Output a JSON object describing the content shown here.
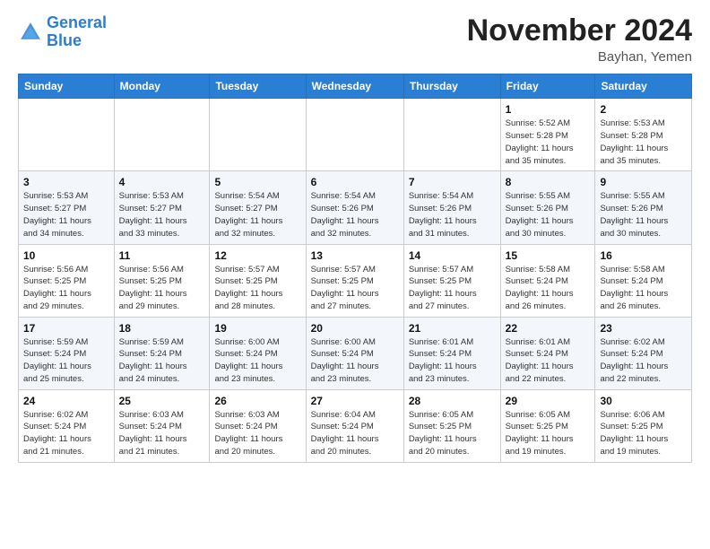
{
  "header": {
    "logo_line1": "General",
    "logo_line2": "Blue",
    "month_title": "November 2024",
    "location": "Bayhan, Yemen"
  },
  "days_of_week": [
    "Sunday",
    "Monday",
    "Tuesday",
    "Wednesday",
    "Thursday",
    "Friday",
    "Saturday"
  ],
  "weeks": [
    [
      {
        "day": "",
        "info": ""
      },
      {
        "day": "",
        "info": ""
      },
      {
        "day": "",
        "info": ""
      },
      {
        "day": "",
        "info": ""
      },
      {
        "day": "",
        "info": ""
      },
      {
        "day": "1",
        "info": "Sunrise: 5:52 AM\nSunset: 5:28 PM\nDaylight: 11 hours\nand 35 minutes."
      },
      {
        "day": "2",
        "info": "Sunrise: 5:53 AM\nSunset: 5:28 PM\nDaylight: 11 hours\nand 35 minutes."
      }
    ],
    [
      {
        "day": "3",
        "info": "Sunrise: 5:53 AM\nSunset: 5:27 PM\nDaylight: 11 hours\nand 34 minutes."
      },
      {
        "day": "4",
        "info": "Sunrise: 5:53 AM\nSunset: 5:27 PM\nDaylight: 11 hours\nand 33 minutes."
      },
      {
        "day": "5",
        "info": "Sunrise: 5:54 AM\nSunset: 5:27 PM\nDaylight: 11 hours\nand 32 minutes."
      },
      {
        "day": "6",
        "info": "Sunrise: 5:54 AM\nSunset: 5:26 PM\nDaylight: 11 hours\nand 32 minutes."
      },
      {
        "day": "7",
        "info": "Sunrise: 5:54 AM\nSunset: 5:26 PM\nDaylight: 11 hours\nand 31 minutes."
      },
      {
        "day": "8",
        "info": "Sunrise: 5:55 AM\nSunset: 5:26 PM\nDaylight: 11 hours\nand 30 minutes."
      },
      {
        "day": "9",
        "info": "Sunrise: 5:55 AM\nSunset: 5:26 PM\nDaylight: 11 hours\nand 30 minutes."
      }
    ],
    [
      {
        "day": "10",
        "info": "Sunrise: 5:56 AM\nSunset: 5:25 PM\nDaylight: 11 hours\nand 29 minutes."
      },
      {
        "day": "11",
        "info": "Sunrise: 5:56 AM\nSunset: 5:25 PM\nDaylight: 11 hours\nand 29 minutes."
      },
      {
        "day": "12",
        "info": "Sunrise: 5:57 AM\nSunset: 5:25 PM\nDaylight: 11 hours\nand 28 minutes."
      },
      {
        "day": "13",
        "info": "Sunrise: 5:57 AM\nSunset: 5:25 PM\nDaylight: 11 hours\nand 27 minutes."
      },
      {
        "day": "14",
        "info": "Sunrise: 5:57 AM\nSunset: 5:25 PM\nDaylight: 11 hours\nand 27 minutes."
      },
      {
        "day": "15",
        "info": "Sunrise: 5:58 AM\nSunset: 5:24 PM\nDaylight: 11 hours\nand 26 minutes."
      },
      {
        "day": "16",
        "info": "Sunrise: 5:58 AM\nSunset: 5:24 PM\nDaylight: 11 hours\nand 26 minutes."
      }
    ],
    [
      {
        "day": "17",
        "info": "Sunrise: 5:59 AM\nSunset: 5:24 PM\nDaylight: 11 hours\nand 25 minutes."
      },
      {
        "day": "18",
        "info": "Sunrise: 5:59 AM\nSunset: 5:24 PM\nDaylight: 11 hours\nand 24 minutes."
      },
      {
        "day": "19",
        "info": "Sunrise: 6:00 AM\nSunset: 5:24 PM\nDaylight: 11 hours\nand 23 minutes."
      },
      {
        "day": "20",
        "info": "Sunrise: 6:00 AM\nSunset: 5:24 PM\nDaylight: 11 hours\nand 23 minutes."
      },
      {
        "day": "21",
        "info": "Sunrise: 6:01 AM\nSunset: 5:24 PM\nDaylight: 11 hours\nand 23 minutes."
      },
      {
        "day": "22",
        "info": "Sunrise: 6:01 AM\nSunset: 5:24 PM\nDaylight: 11 hours\nand 22 minutes."
      },
      {
        "day": "23",
        "info": "Sunrise: 6:02 AM\nSunset: 5:24 PM\nDaylight: 11 hours\nand 22 minutes."
      }
    ],
    [
      {
        "day": "24",
        "info": "Sunrise: 6:02 AM\nSunset: 5:24 PM\nDaylight: 11 hours\nand 21 minutes."
      },
      {
        "day": "25",
        "info": "Sunrise: 6:03 AM\nSunset: 5:24 PM\nDaylight: 11 hours\nand 21 minutes."
      },
      {
        "day": "26",
        "info": "Sunrise: 6:03 AM\nSunset: 5:24 PM\nDaylight: 11 hours\nand 20 minutes."
      },
      {
        "day": "27",
        "info": "Sunrise: 6:04 AM\nSunset: 5:24 PM\nDaylight: 11 hours\nand 20 minutes."
      },
      {
        "day": "28",
        "info": "Sunrise: 6:05 AM\nSunset: 5:25 PM\nDaylight: 11 hours\nand 20 minutes."
      },
      {
        "day": "29",
        "info": "Sunrise: 6:05 AM\nSunset: 5:25 PM\nDaylight: 11 hours\nand 19 minutes."
      },
      {
        "day": "30",
        "info": "Sunrise: 6:06 AM\nSunset: 5:25 PM\nDaylight: 11 hours\nand 19 minutes."
      }
    ]
  ]
}
